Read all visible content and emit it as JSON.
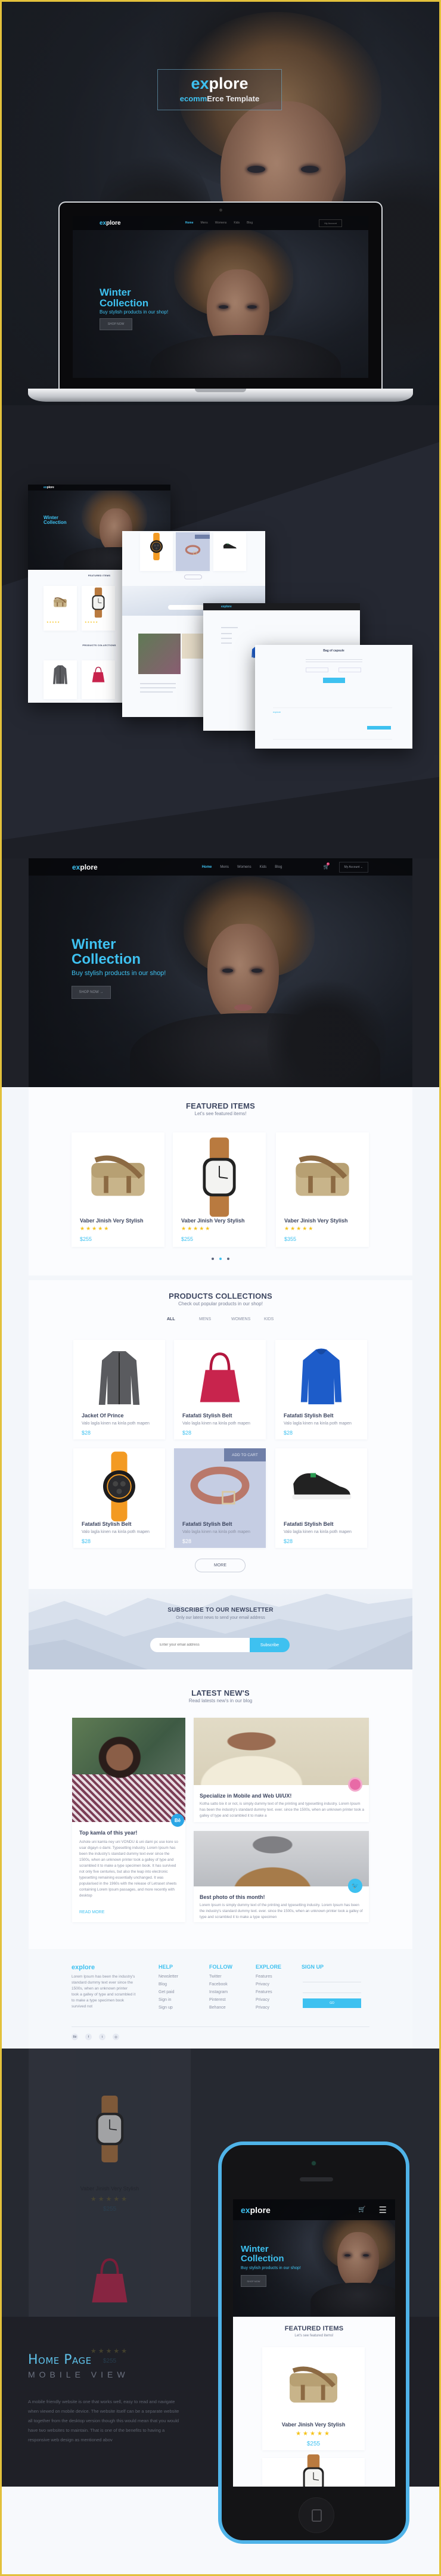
{
  "colors": {
    "accent": "#3ec1f0",
    "star": "#f5c31c",
    "heading": "#3d4660",
    "frame": "#e3c13b",
    "phone": "#4fb3e8",
    "add_to_cart": "#6f7fa8"
  },
  "cover": {
    "logo": {
      "prefix": "ex",
      "rest": "plore"
    },
    "subtitle": {
      "accent": "ecomm",
      "rest": "Erce Template"
    }
  },
  "site": {
    "logo": {
      "prefix": "ex",
      "rest": "plore"
    },
    "nav": [
      {
        "label": "Home",
        "active": true
      },
      {
        "label": "Mens"
      },
      {
        "label": "Womens"
      },
      {
        "label": "Kids"
      },
      {
        "label": "Blog"
      }
    ],
    "cart_icon": "cart-icon",
    "cart_count": "0",
    "account": "My Account",
    "hero": {
      "title1": "Winter",
      "title2": "Collection",
      "subtitle": "Buy stylish products in our shop!",
      "button": "SHOP NOW",
      "button_icon": "arrow-right-icon"
    },
    "featured": {
      "title": "FEATURED ITEMS",
      "subtitle": "Let's see featured items!",
      "items": [
        {
          "name": "Vaber Jinish Very Stylish",
          "rating": 5,
          "price": "$255",
          "image": "bag"
        },
        {
          "name": "Vaber Jinish Very Stylish",
          "rating": 5,
          "price": "$255",
          "image": "watch-brown"
        },
        {
          "name": "Vaber Jinish Very Stylish",
          "rating": 5,
          "price": "$355",
          "image": "bag"
        }
      ],
      "carousel": {
        "pages": 3,
        "active": 2
      }
    },
    "collections": {
      "title": "PRODUCTS COLLECTIONS",
      "subtitle": "Check out popular products in our shop!",
      "tabs": [
        {
          "label": "ALL",
          "active": true
        },
        {
          "label": "MENS"
        },
        {
          "label": "WOMENS"
        },
        {
          "label": "KIDS"
        }
      ],
      "items": [
        {
          "name": "Jacket Of Prince",
          "desc": "Valo lagla kinen na kinla poth mapen",
          "price": "$28",
          "image": "jacket-gray"
        },
        {
          "name": "Fatafati Stylish Belt",
          "desc": "Valo lagla kinen na kinla poth mapen",
          "price": "$28",
          "image": "handbag"
        },
        {
          "name": "Fatafati Stylish Belt",
          "desc": "Valo lagla kinen na kinla poth mapen",
          "price": "$28",
          "image": "jacket-blue"
        },
        {
          "name": "Fatafati Stylish Belt",
          "desc": "Valo lagla kinen na kinla poth mapen",
          "price": "$28",
          "image": "watch-orange"
        },
        {
          "name": "Fatafati Stylish Belt",
          "desc": "Valo lagla kinen na kinla poth mapen",
          "price": "$28",
          "image": "belt",
          "hover": true
        },
        {
          "name": "Fatafati Stylish Belt",
          "desc": "Valo lagla kinen na kinla poth mapen",
          "price": "$28",
          "image": "sneaker"
        }
      ],
      "add_to_cart": "ADD TO CART",
      "more": "MORE"
    },
    "newsletter": {
      "title": "SUBSCRIBE TO OUR NEWSLETTER",
      "subtitle": "Only our latest news to send your email address",
      "placeholder": "Enter your email address",
      "button": "Subscribe"
    },
    "news": {
      "title": "LATEST NEW'S",
      "subtitle": "Read latests new's in our blog",
      "posts": [
        {
          "title": "Top kamla of this year!",
          "badge": "Bē",
          "body": "Ashole uni kamla ney uni VONDU & uni dami pc use kore so usar digayn o dami. Typesetting industry. Lorem Ipsum has been the industry's standard dummy text ever since the 1500s, when an unknown printer took a galley of type and scrambled it to make a type specimen book. It has survived not only five centuries, but also the leap into electronic typesetting remaining essentially unchanged. It was popularised in the 1960s with the release of Letraset sheets containing Lorem Ipsum passages, and more recently with desktop",
          "link": "READ MORE"
        },
        {
          "title": "Specialize in Mobile and Web UI/UX!",
          "badge_icon": "dribbble-icon",
          "body": "Kotha satto bix it or not, is simply dummy text of the printing and typesetting industry. Lorem Ipsum has been the industry's standard dummy text. ever. since the 1500s, when an unknown printer took a galley of type and scrambled it to make a"
        },
        {
          "title": "Best photo of this month!",
          "badge_icon": "twitter-icon",
          "body": "Lorem Ipsum is simply dummy text of the printing and typesetting industry. Lorem Ipsum has been the industry's standard dummy text. ever. since the 1500s, when an unknown printer took a galley of type and scrambled it to make a type specimen"
        }
      ]
    },
    "footer": {
      "logo": "explore",
      "about": "Lorem Ipsum has been the industry's standard dummy text ever since the 1500s, when an unknown printer took a galley of type and scrambled it to make a type specimen book survived not",
      "columns": [
        {
          "title": "HELP",
          "links": [
            "Newsletter",
            "Blog",
            "Get paid",
            "Sign in",
            "Sign up"
          ]
        },
        {
          "title": "FOLLOW",
          "links": [
            "Twitter",
            "Facebook",
            "Instagram",
            "Pinterest",
            "Behance"
          ]
        },
        {
          "title": "EXPLORE",
          "links": [
            "Features",
            "Privacy",
            "Features",
            "Privacy",
            "Privacy"
          ]
        }
      ],
      "signup": {
        "title": "SIGN UP",
        "button": "GO"
      },
      "social": [
        "behance-icon",
        "facebook-icon",
        "twitter-icon",
        "dribbble-icon"
      ]
    }
  },
  "mockups": {
    "modal_title": "Bag of capsule"
  },
  "mobile": {
    "title": "Home Page",
    "subtitle": "MOBILE VIEW",
    "description": "A mobile friendly website is one that works well, easy to read and navigate when viewed on mobile  device. The website itself can be a separate website all together from the desktop version though this would mean that you would have two websites to maintain. That is one of the benefits to having a responsive web design as mentioned abov",
    "menu_icon": "hamburger-menu-icon",
    "faded_items": [
      {
        "name": "Vaber Jinish Very Stylish",
        "price": "$255",
        "image": "watch-brown"
      },
      {
        "name": "Vaber Jinish Very Stylish",
        "price": "$255",
        "image": "handbag"
      }
    ]
  }
}
